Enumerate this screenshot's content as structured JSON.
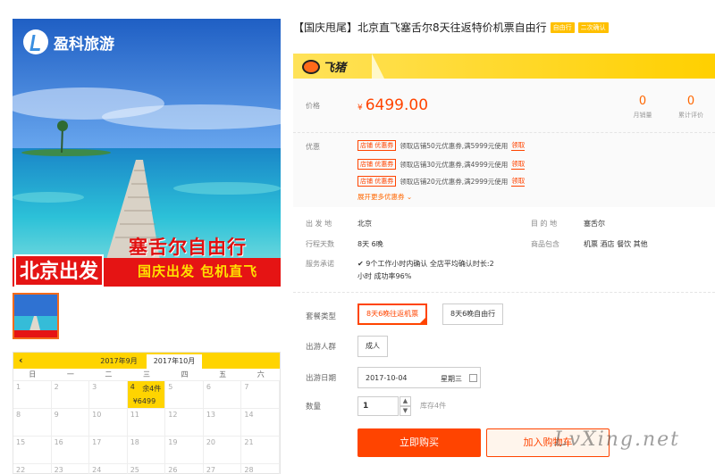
{
  "hero": {
    "brand": "盈科旅游",
    "promo_title": "塞舌尔自由行",
    "promo_city": "北京出发",
    "promo_tags": "国庆出发 包机直飞"
  },
  "calendar": {
    "prev_icon": "chevron-left-icon",
    "prev_glyph": "‹",
    "tabs": [
      "2017年9月",
      "2017年10月"
    ],
    "weekdays": [
      "日",
      "一",
      "二",
      "三",
      "四",
      "五",
      "六"
    ],
    "rows": [
      [
        "1",
        "2",
        "3",
        "4",
        "5",
        "6",
        "7"
      ],
      [
        "8",
        "9",
        "10",
        "11",
        "12",
        "13",
        "14"
      ],
      [
        "15",
        "16",
        "17",
        "18",
        "19",
        "20",
        "21"
      ],
      [
        "22",
        "23",
        "24",
        "25",
        "26",
        "27",
        "28"
      ]
    ],
    "selected": {
      "day": "4",
      "stock": "余4件",
      "price": "¥6499"
    }
  },
  "product": {
    "title": "【国庆甩尾】北京直飞塞舌尔8天往返特价机票自由行",
    "tags": [
      "自由行",
      "二次确认"
    ]
  },
  "platform": {
    "name": "飞猪"
  },
  "price": {
    "label": "价格",
    "currency": "¥",
    "value": "6499.00",
    "monthly_sales": "0",
    "monthly_sales_label": "月销量",
    "reviews": "0",
    "reviews_label": "累计评价"
  },
  "coupons": {
    "label": "优惠",
    "tag": "店铺 优惠券",
    "items": [
      {
        "text": "领取店铺50元优惠券,满5999元使用",
        "action": "领取"
      },
      {
        "text": "领取店铺30元优惠券,满4999元使用",
        "action": "领取"
      },
      {
        "text": "领取店铺20元优惠券,满2999元使用",
        "action": "领取"
      }
    ],
    "more": "展开更多优惠券 ⌄"
  },
  "info": {
    "departure_label": "出 发 地",
    "departure": "北京",
    "destination_label": "目 的 地",
    "destination": "塞舌尔",
    "days_label": "行程天数",
    "days": "8天 6晚",
    "includes_label": "商品包含",
    "includes": "机票 酒店 餐饮 其他",
    "service_label": "服务承诺",
    "service_line1": "9个工作小时内确认 全店平均确认时长:2",
    "service_line2": "小时 成功率96%"
  },
  "sku": {
    "package_label": "套餐类型",
    "packages": [
      "8天6晚往返机票",
      "8天6晚自由行"
    ],
    "crowd_label": "出游人群",
    "crowd": "成人",
    "date_label": "出游日期",
    "date": "2017-10-04",
    "weekday": "星期三",
    "qty_label": "数量",
    "qty": "1",
    "stock": "库存4件",
    "buy": "立即购买",
    "cart": "加入购物车"
  },
  "watermark": "LvXing.net",
  "colors": {
    "accent": "#ff4400",
    "yellow": "#ffd400",
    "tag": "#ffc000"
  }
}
